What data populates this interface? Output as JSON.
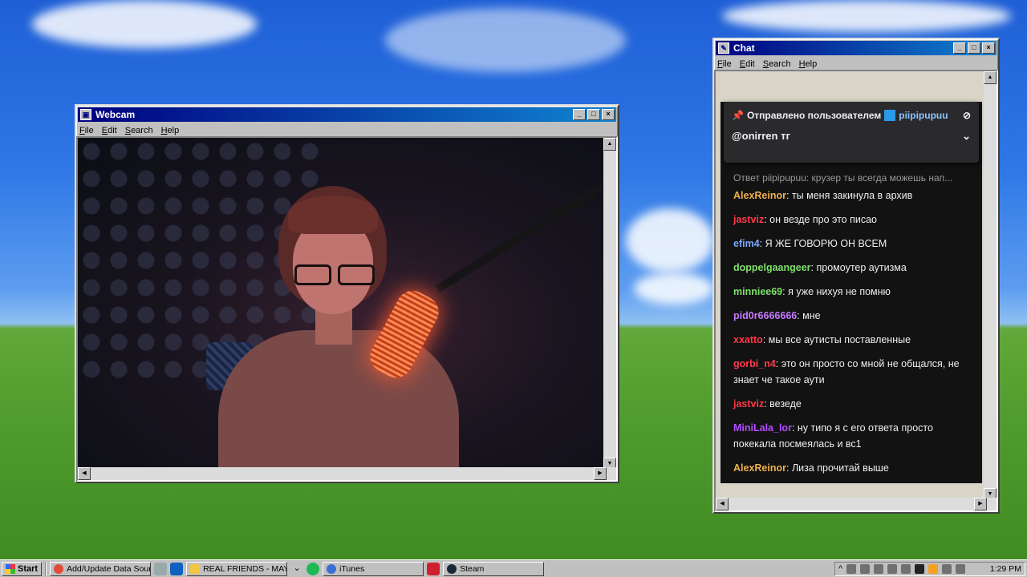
{
  "webcam_window": {
    "title": "Webcam",
    "menu": [
      "File",
      "Edit",
      "Search",
      "Help"
    ]
  },
  "chat_window": {
    "title": "Chat",
    "menu": [
      "File",
      "Edit",
      "Search",
      "Help"
    ],
    "pinned": {
      "header": "Отправлено пользователем",
      "user": "piipipupuu",
      "message": "@onirren тг"
    },
    "messages": [
      {
        "type": "reply",
        "text": "Ответ piipipupuu: крузер ты всегда можешь нап..."
      },
      {
        "user": "AlexReinor",
        "color": "#f0b04a",
        "text": ": ты меня закинула в архив"
      },
      {
        "user": "jastviz",
        "color": "#ff3a4a",
        "text": ": он везде про это писао"
      },
      {
        "user": "efim4",
        "color": "#7aa8ff",
        "text": ": Я ЖЕ ГОВОРЮ ОН ВСЕМ"
      },
      {
        "user": "doppelgaangeer",
        "color": "#7ee06a",
        "text": ": промоутер аутизма"
      },
      {
        "user": "minniee69",
        "color": "#7ee06a",
        "text": ": я уже нихуя не помню"
      },
      {
        "user": "pid0r6666666",
        "color": "#c67cff",
        "text": ": мне"
      },
      {
        "user": "xxatto",
        "color": "#ff3a4a",
        "text": ": мы все аутисты поставленные"
      },
      {
        "user": "gorbi_n4",
        "color": "#ff3a4a",
        "text": ": это он просто со мной не общался, не знает че такое аути"
      },
      {
        "user": "jastviz",
        "color": "#ff3a4a",
        "text": ": везеде"
      },
      {
        "user": "MiniLala_lor",
        "color": "#b44cff",
        "text": ": ну типо я с его ответа просто покекала посмеялась и вс1"
      },
      {
        "user": "AlexReinor",
        "color": "#f0b04a",
        "text": ": Лиза прочитай выше"
      }
    ]
  },
  "taskbar": {
    "start_label": "Start",
    "tasks": [
      {
        "label": "Add/Update Data Source...",
        "icon_color": "#e24a3a"
      },
      {
        "label": "REAL FRIENDS - MAYB...",
        "icon_color": "#f4c542"
      },
      {
        "label": "iTunes",
        "icon_color": "#3a6fd8"
      },
      {
        "label": "Steam",
        "icon_color": "#1b2838"
      }
    ],
    "clock": "1:29 PM"
  }
}
